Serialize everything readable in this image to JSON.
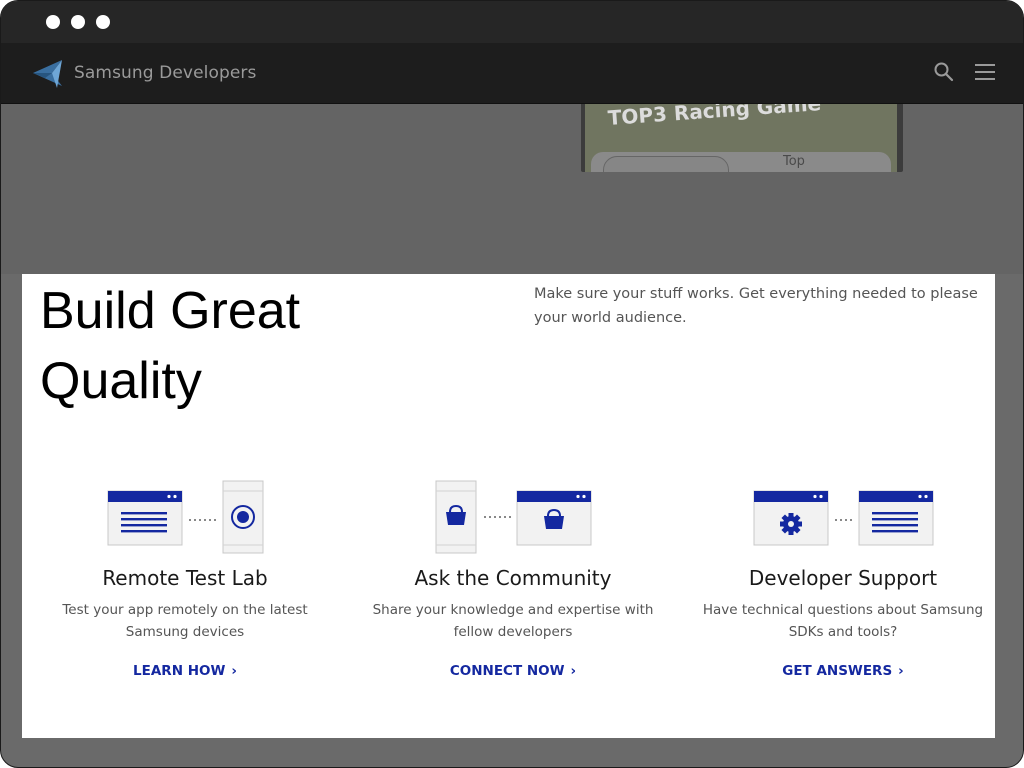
{
  "window": {
    "controls": [
      "window-dot",
      "window-dot",
      "window-dot"
    ]
  },
  "nav": {
    "brand": "Samsung Developers",
    "icons": [
      "samsung-developers-logo-icon",
      "search-icon",
      "hamburger-menu-icon"
    ]
  },
  "hero": {
    "game_title": "TOP3 Racing Game",
    "game_label": "Top"
  },
  "section": {
    "heading": "Build Great Quality",
    "intro": "Make sure your stuff works. Get everything needed to please your world audience."
  },
  "cards": [
    {
      "title": "Remote Test Lab",
      "desc": "Test your app remotely on the latest Samsung devices",
      "link": "LEARN HOW",
      "icon": "remote-test-lab-icon"
    },
    {
      "title": "Ask the Community",
      "desc": "Share your knowledge and expertise with fellow developers",
      "link": "CONNECT NOW",
      "icon": "community-icon"
    },
    {
      "title": "Developer Support",
      "desc": "Have technical questions about Samsung SDKs and tools?",
      "link": "GET ANSWERS",
      "icon": "developer-support-icon"
    }
  ],
  "colors": {
    "accent": "#1428a0",
    "overlay": "#666666",
    "nav_bg": "#1d1d1d"
  }
}
